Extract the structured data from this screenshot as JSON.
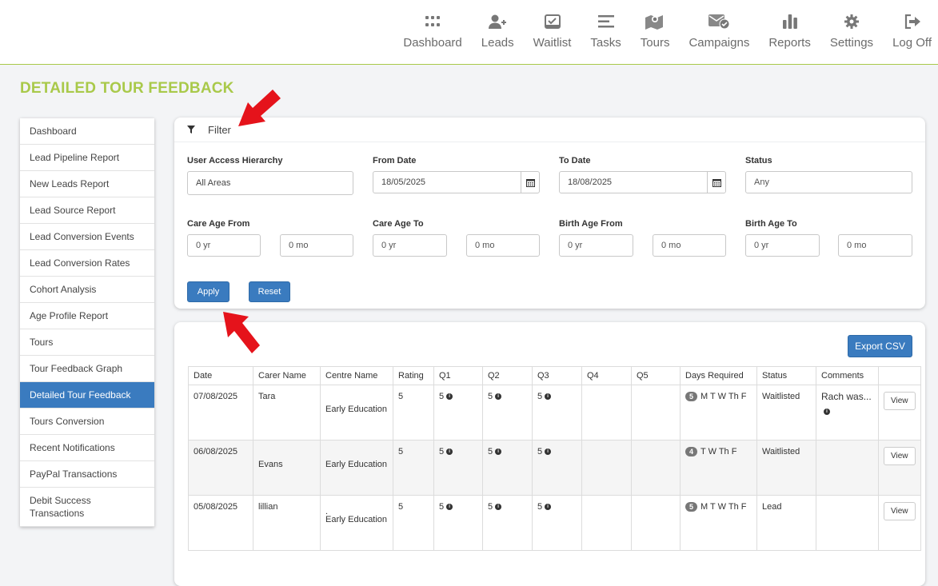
{
  "nav": [
    {
      "label": "Dashboard",
      "icon": "dashboard-grid-icon"
    },
    {
      "label": "Leads",
      "icon": "user-plus-icon"
    },
    {
      "label": "Waitlist",
      "icon": "inbox-check-icon"
    },
    {
      "label": "Tasks",
      "icon": "list-icon"
    },
    {
      "label": "Tours",
      "icon": "map-marker-icon"
    },
    {
      "label": "Campaigns",
      "icon": "envelope-check-icon"
    },
    {
      "label": "Reports",
      "icon": "bar-chart-icon"
    },
    {
      "label": "Settings",
      "icon": "gear-icon"
    },
    {
      "label": "Log Off",
      "icon": "sign-out-icon"
    }
  ],
  "page_title": "DETAILED TOUR FEEDBACK",
  "sidebar": [
    "Dashboard",
    "Lead Pipeline Report",
    "New Leads Report",
    "Lead Source Report",
    "Lead Conversion Events",
    "Lead Conversion Rates",
    "Cohort Analysis",
    "Age Profile Report",
    "Tours",
    "Tour Feedback Graph",
    "Detailed Tour Feedback",
    "Tours Conversion",
    "Recent Notifications",
    "PayPal Transactions",
    "Debit Success Transactions"
  ],
  "filter": {
    "title": "Filter",
    "user_access_label": "User Access Hierarchy",
    "user_access_value": "All Areas",
    "from_date_label": "From Date",
    "from_date_value": "18/05/2025",
    "to_date_label": "To Date",
    "to_date_value": "18/08/2025",
    "status_label": "Status",
    "status_placeholder": "Any",
    "care_age_from_label": "Care Age From",
    "care_age_to_label": "Care Age To",
    "birth_age_from_label": "Birth Age From",
    "birth_age_to_label": "Birth Age To",
    "yr_placeholder": "0 yr",
    "mo_placeholder": "0 mo",
    "apply": "Apply",
    "reset": "Reset"
  },
  "export_csv": "Export CSV",
  "table": {
    "headers": [
      "Date",
      "Carer Name",
      "Centre Name",
      "Rating",
      "Q1",
      "Q2",
      "Q3",
      "Q4",
      "Q5",
      "Days Required",
      "Status",
      "Comments",
      ""
    ],
    "rows": [
      {
        "date": "07/08/2025",
        "carer": "Tara",
        "centre_dot": "",
        "centre": "Early Education",
        "rating": "5",
        "q1": "5",
        "q2": "5",
        "q3": "5",
        "days_count": "5",
        "days": "M T W Th F",
        "status": "Waitlisted",
        "comment": "Rach was...",
        "view": "View"
      },
      {
        "date": "06/08/2025",
        "carer": "Evans",
        "centre_dot": "",
        "centre": "Early Education",
        "rating": "5",
        "q1": "5",
        "q2": "5",
        "q3": "5",
        "days_count": "4",
        "days": "T W Th F",
        "status": "Waitlisted",
        "comment": "",
        "view": "View"
      },
      {
        "date": "05/08/2025",
        "carer": "lillian",
        "centre_dot": ".",
        "centre": "Early Education",
        "rating": "5",
        "q1": "5",
        "q2": "5",
        "q3": "5",
        "days_count": "5",
        "days": "M T W Th F",
        "status": "Lead",
        "comment": "",
        "view": "View"
      }
    ]
  },
  "colors": {
    "accent_green": "#a9c94a",
    "primary_blue": "#3a7bbf",
    "arrow_red": "#e5131b"
  }
}
